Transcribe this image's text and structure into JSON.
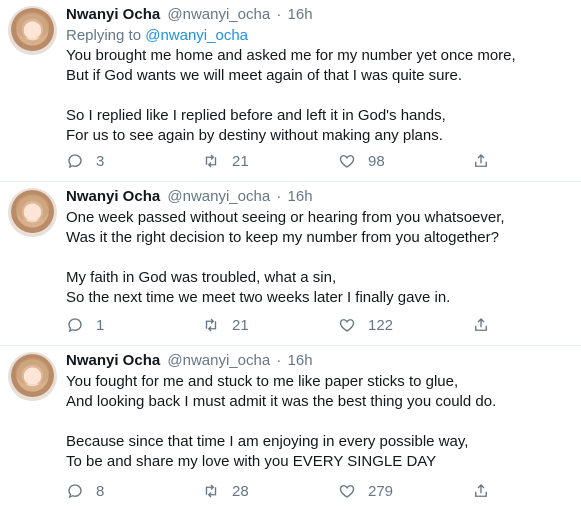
{
  "tweets": [
    {
      "name": "Nwanyi Ocha",
      "handle": "@nwanyi_ocha",
      "dot": "·",
      "time": "16h",
      "replying_prefix": "Replying to",
      "replying_handle": "@nwanyi_ocha",
      "lines": [
        "You brought me home and asked me for my number yet once more,",
        "But if God wants we will meet again of that I was quite sure.",
        "So I replied like I replied before and left it in God's hands,",
        "For us to see again by destiny without making any plans."
      ],
      "replies": "3",
      "retweets": "21",
      "likes": "98"
    },
    {
      "name": "Nwanyi Ocha",
      "handle": "@nwanyi_ocha",
      "dot": "·",
      "time": "16h",
      "lines": [
        "One week passed without seeing or hearing from you whatsoever,",
        "Was it the right decision to keep my number from you altogether?",
        "My faith in God was troubled, what a sin,",
        "So the next time we meet two weeks later I finally gave in."
      ],
      "replies": "1",
      "retweets": "21",
      "likes": "122"
    },
    {
      "name": "Nwanyi Ocha",
      "handle": "@nwanyi_ocha",
      "dot": "·",
      "time": "16h",
      "lines": [
        "You fought for me and stuck to me like paper sticks to glue,",
        "And looking back I must admit it was the best thing you could do.",
        "Because since that time I am enjoying in every possible way,",
        "To be and share my love with you EVERY SINGLE DAY"
      ],
      "replies": "8",
      "retweets": "28",
      "likes": "279"
    }
  ],
  "icons": {
    "reply": "speech-bubble-icon",
    "retweet": "retweet-icon",
    "like": "heart-icon",
    "share": "share-icon"
  }
}
